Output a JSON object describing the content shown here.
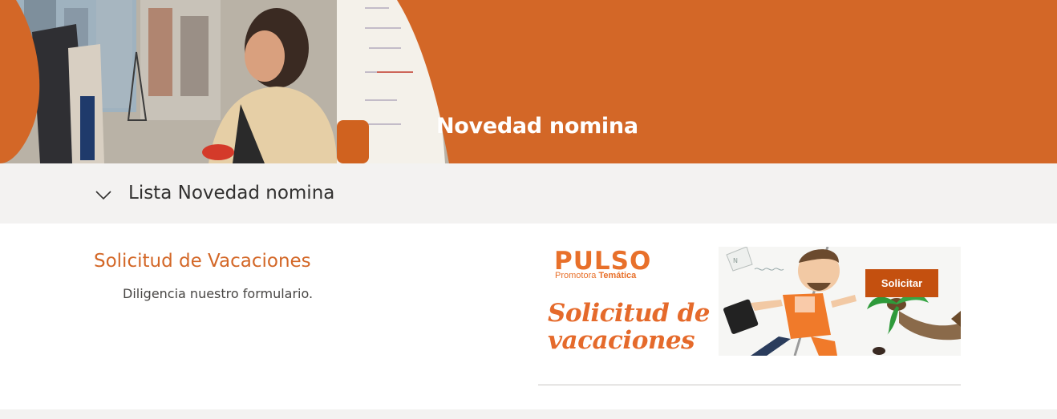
{
  "hero": {
    "title": "Novedad nomina"
  },
  "section": {
    "title": "Lista Novedad nomina"
  },
  "card": {
    "title": "Solicitud de Vacaciones",
    "description": "Diligencia nuestro formulario."
  },
  "banner": {
    "logo": "PULSO",
    "sub_prefix": "Promotora ",
    "sub_bold": "Temática",
    "script_line1": "Solicitud de",
    "script_line2": "vacaciones",
    "button_label": "Solicitar"
  },
  "colors": {
    "accent": "#d36727",
    "button": "#c4500f",
    "section_bg": "#f3f2f1"
  },
  "icons": {
    "section_toggle": "chevron-down-icon"
  }
}
